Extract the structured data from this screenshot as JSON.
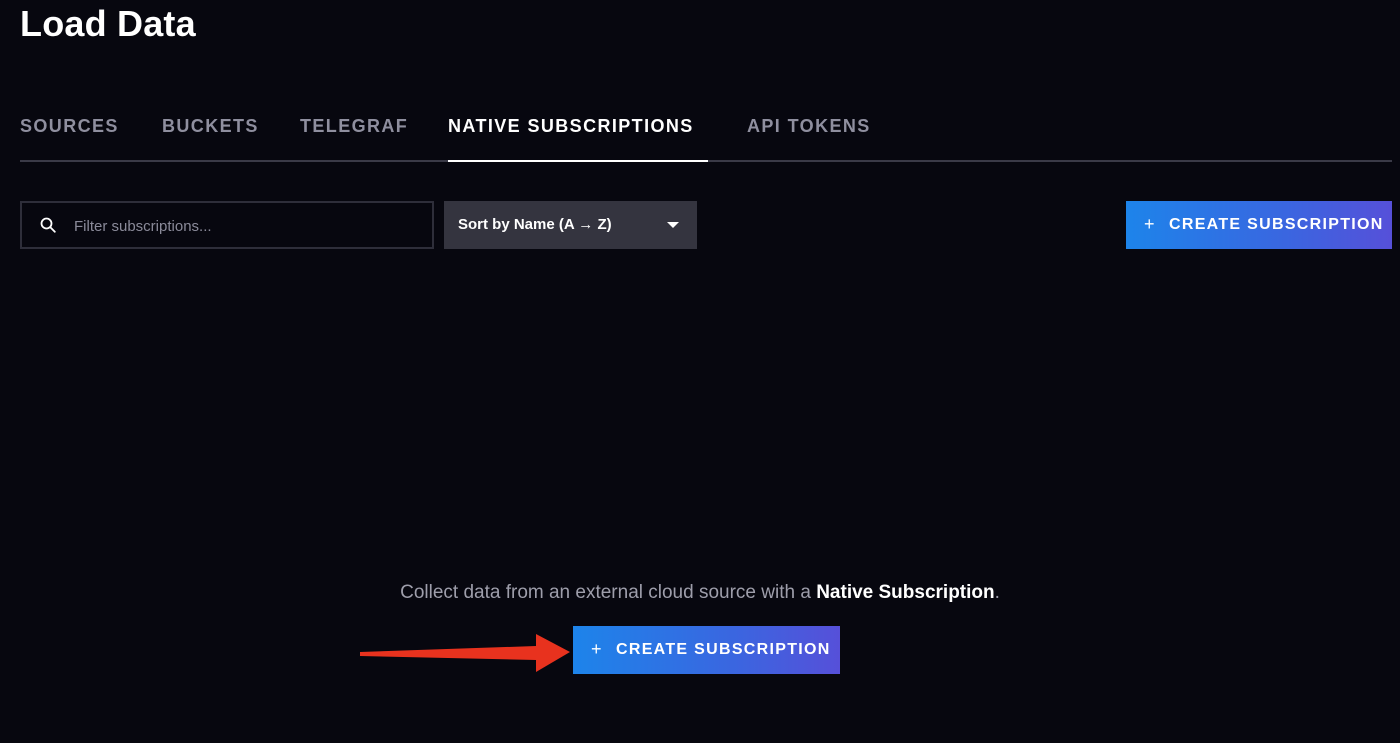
{
  "page": {
    "title": "Load Data"
  },
  "tabs": [
    {
      "label": "SOURCES",
      "active": false
    },
    {
      "label": "BUCKETS",
      "active": false
    },
    {
      "label": "TELEGRAF",
      "active": false
    },
    {
      "label": "NATIVE SUBSCRIPTIONS",
      "active": true
    },
    {
      "label": "API TOKENS",
      "active": false
    }
  ],
  "toolbar": {
    "search": {
      "placeholder": "Filter subscriptions...",
      "value": "",
      "icon": "search-icon"
    },
    "sort": {
      "selected": "Sort by Name (A → Z)",
      "icon": "caret-down-icon"
    },
    "create_button": {
      "icon": "+",
      "label": "CREATE SUBSCRIPTION"
    }
  },
  "empty_state": {
    "text_prefix": "Collect data from an external cloud source with a ",
    "text_bold": "Native Subscription",
    "text_suffix": ".",
    "create_button": {
      "icon": "+",
      "label": "CREATE SUBSCRIPTION"
    }
  },
  "annotation": {
    "arrow_color": "#e8321e"
  },
  "colors": {
    "background": "#07070f",
    "accent_gradient_start": "#1d84ea",
    "accent_gradient_end": "#5650d9",
    "tab_inactive": "#8f8f9f",
    "dropdown_bg": "#34343f"
  }
}
